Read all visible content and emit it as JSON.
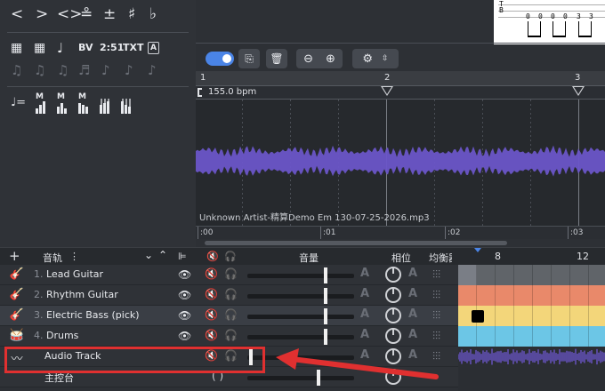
{
  "palette": {
    "row1": [
      "<",
      ">",
      "<>",
      "≗",
      "±",
      "♯",
      "♭"
    ],
    "row2_labels": [
      "BV",
      "2:51",
      "TXT",
      "A"
    ],
    "row3": [
      "♩=",
      "M",
      "M",
      "M",
      "|||",
      "|||"
    ]
  },
  "tab_preview": {
    "string_letter": "B",
    "numbers": [
      "0",
      "0",
      "0",
      "0",
      "3",
      "3"
    ]
  },
  "audio_editor": {
    "bpm": "155.0 bpm",
    "bar_numbers": [
      "1",
      "2",
      "3"
    ],
    "file_name": "Unknown Artist-精算Demo Em 130-07-25-2026.mp3",
    "time_labels": [
      ":00",
      ":01",
      ":02",
      ":03"
    ],
    "toolbar": {
      "toggle": "on",
      "buttons": [
        "import-audio-icon",
        "trash-icon",
        "zoom-out-icon",
        "zoom-in-icon",
        "gear-icon"
      ]
    },
    "colors": {
      "waveform": "#6a55c8",
      "accent": "#4a84e6"
    }
  },
  "track_header": {
    "add": "+",
    "tracks_label": "音轨",
    "more": "⋮",
    "volume_label": "音量",
    "pan_label": "相位",
    "eq_label": "均衡器",
    "beat_numbers": [
      "8",
      "12"
    ]
  },
  "tracks": [
    {
      "index": "1.",
      "name": "Lead Guitar",
      "icon": "guitar-icon",
      "volume": 0.72,
      "color": "#606469"
    },
    {
      "index": "2.",
      "name": "Rhythm Guitar",
      "icon": "guitar-icon",
      "volume": 0.72,
      "color": "#e9896a"
    },
    {
      "index": "3.",
      "name": "Electric Bass (pick)",
      "icon": "bass-icon",
      "volume": 0.72,
      "color": "#f3d67a"
    },
    {
      "index": "4.",
      "name": "Drums",
      "icon": "drum-icon",
      "volume": 0.72,
      "color": "#6cc6e6"
    },
    {
      "index": "",
      "name": "Audio Track",
      "icon": "audio-wave-icon",
      "volume": 0.02,
      "color": "#6a55c8"
    },
    {
      "index": "",
      "name": "主控台",
      "icon": "",
      "volume": 0.65,
      "color": "#2b2e33"
    }
  ]
}
